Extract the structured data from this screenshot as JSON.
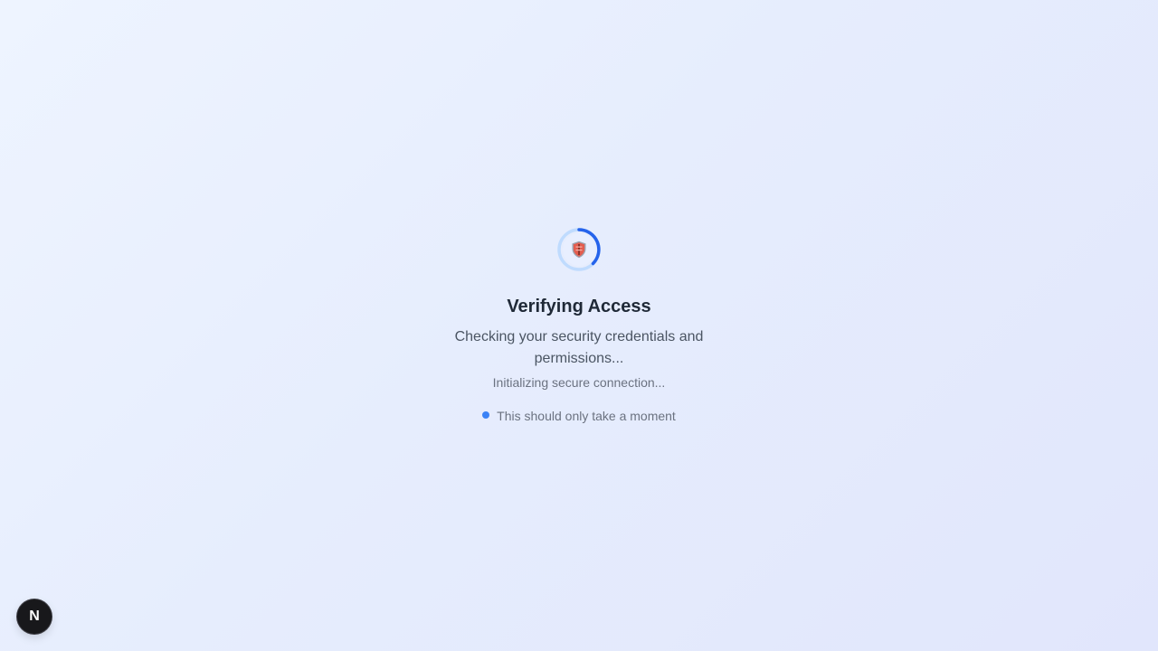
{
  "loader": {
    "title": "Verifying Access",
    "subtitle": "Checking your security credentials and permissions...",
    "status": "Initializing secure connection...",
    "hint": "This should only take a moment",
    "icon": "shield-icon",
    "spinner_icon": "spinner-icon"
  },
  "dev_badge": {
    "label": "N",
    "icon": "next-logo-icon"
  },
  "colors": {
    "accent": "#3b82f6",
    "spinner_track": "#bfdbfe",
    "spinner_arc": "#2563eb",
    "title": "#1f2937",
    "subtitle": "#4b5563",
    "muted": "#6b7280",
    "badge_bg": "#18181b"
  }
}
